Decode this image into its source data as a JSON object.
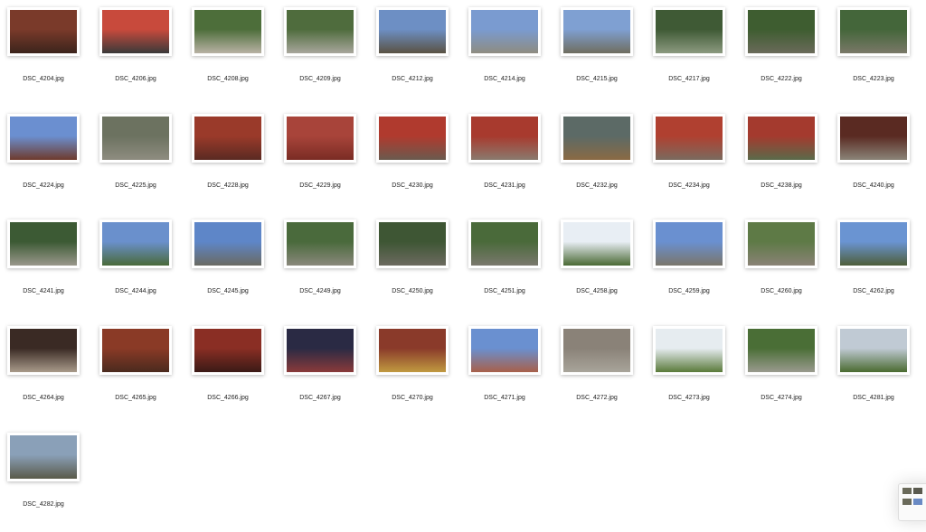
{
  "files": [
    {
      "name": "DSC_4204.jpg",
      "c1": "#7a3a2a",
      "c2": "#3b241c"
    },
    {
      "name": "DSC_4206.jpg",
      "c1": "#c84a3c",
      "c2": "#3a3a3a"
    },
    {
      "name": "DSC_4208.jpg",
      "c1": "#4d6e3a",
      "c2": "#b8b2a4"
    },
    {
      "name": "DSC_4209.jpg",
      "c1": "#4f6c3d",
      "c2": "#a8a69c"
    },
    {
      "name": "DSC_4212.jpg",
      "c1": "#6d8fc4",
      "c2": "#5a5243"
    },
    {
      "name": "DSC_4214.jpg",
      "c1": "#7a9bd0",
      "c2": "#8e8c80"
    },
    {
      "name": "DSC_4215.jpg",
      "c1": "#7fa0d2",
      "c2": "#6f6d5f"
    },
    {
      "name": "DSC_4217.jpg",
      "c1": "#3f5a35",
      "c2": "#8c9a80"
    },
    {
      "name": "DSC_4222.jpg",
      "c1": "#3e5d30",
      "c2": "#6a6a5a"
    },
    {
      "name": "DSC_4223.jpg",
      "c1": "#44663a",
      "c2": "#7a7868"
    },
    {
      "name": "DSC_4224.jpg",
      "c1": "#6b8fd0",
      "c2": "#6e3a2c"
    },
    {
      "name": "DSC_4225.jpg",
      "c1": "#6c7260",
      "c2": "#8e8c80"
    },
    {
      "name": "DSC_4228.jpg",
      "c1": "#9a3a2a",
      "c2": "#5a2a22"
    },
    {
      "name": "DSC_4229.jpg",
      "c1": "#a8443a",
      "c2": "#7a2c24"
    },
    {
      "name": "DSC_4230.jpg",
      "c1": "#b03a2e",
      "c2": "#6a5a4e"
    },
    {
      "name": "DSC_4231.jpg",
      "c1": "#a83a2e",
      "c2": "#8a7a6e"
    },
    {
      "name": "DSC_4232.jpg",
      "c1": "#5c6a66",
      "c2": "#8a6a44"
    },
    {
      "name": "DSC_4234.jpg",
      "c1": "#b04030",
      "c2": "#7a6a5e"
    },
    {
      "name": "DSC_4238.jpg",
      "c1": "#a43a2e",
      "c2": "#5a6a4a"
    },
    {
      "name": "DSC_4240.jpg",
      "c1": "#5a2a22",
      "c2": "#8a8478"
    },
    {
      "name": "DSC_4241.jpg",
      "c1": "#3c5a34",
      "c2": "#9a988c"
    },
    {
      "name": "DSC_4244.jpg",
      "c1": "#6a90cc",
      "c2": "#4a6a3a"
    },
    {
      "name": "DSC_4245.jpg",
      "c1": "#5e86c8",
      "c2": "#6a6a62"
    },
    {
      "name": "DSC_4249.jpg",
      "c1": "#4a6a3c",
      "c2": "#8a887c"
    },
    {
      "name": "DSC_4250.jpg",
      "c1": "#3e5634",
      "c2": "#6c6a60"
    },
    {
      "name": "DSC_4251.jpg",
      "c1": "#4a6a3a",
      "c2": "#7a786e"
    },
    {
      "name": "DSC_4258.jpg",
      "c1": "#e8eef4",
      "c2": "#4a6a34"
    },
    {
      "name": "DSC_4259.jpg",
      "c1": "#6a90d0",
      "c2": "#7a766a"
    },
    {
      "name": "DSC_4260.jpg",
      "c1": "#5e7a46",
      "c2": "#8a8276"
    },
    {
      "name": "DSC_4262.jpg",
      "c1": "#6a94d2",
      "c2": "#4e5e3a"
    },
    {
      "name": "DSC_4264.jpg",
      "c1": "#3a2a24",
      "c2": "#a89a8a"
    },
    {
      "name": "DSC_4265.jpg",
      "c1": "#8a3a26",
      "c2": "#4a2a1e"
    },
    {
      "name": "DSC_4266.jpg",
      "c1": "#8a2e24",
      "c2": "#3a1a16"
    },
    {
      "name": "DSC_4267.jpg",
      "c1": "#2a2a44",
      "c2": "#8a3a3a"
    },
    {
      "name": "DSC_4270.jpg",
      "c1": "#8a3a2a",
      "c2": "#c09a40"
    },
    {
      "name": "DSC_4271.jpg",
      "c1": "#6a90d0",
      "c2": "#a8604a"
    },
    {
      "name": "DSC_4272.jpg",
      "c1": "#8a8278",
      "c2": "#a8a49a"
    },
    {
      "name": "DSC_4273.jpg",
      "c1": "#e6ecf0",
      "c2": "#5a7a3a"
    },
    {
      "name": "DSC_4274.jpg",
      "c1": "#4a6e36",
      "c2": "#9a9a8e"
    },
    {
      "name": "DSC_4281.jpg",
      "c1": "#c0cad4",
      "c2": "#4a6a30"
    },
    {
      "name": "DSC_4282.jpg",
      "c1": "#8aa0b8",
      "c2": "#5a5a4a"
    }
  ]
}
